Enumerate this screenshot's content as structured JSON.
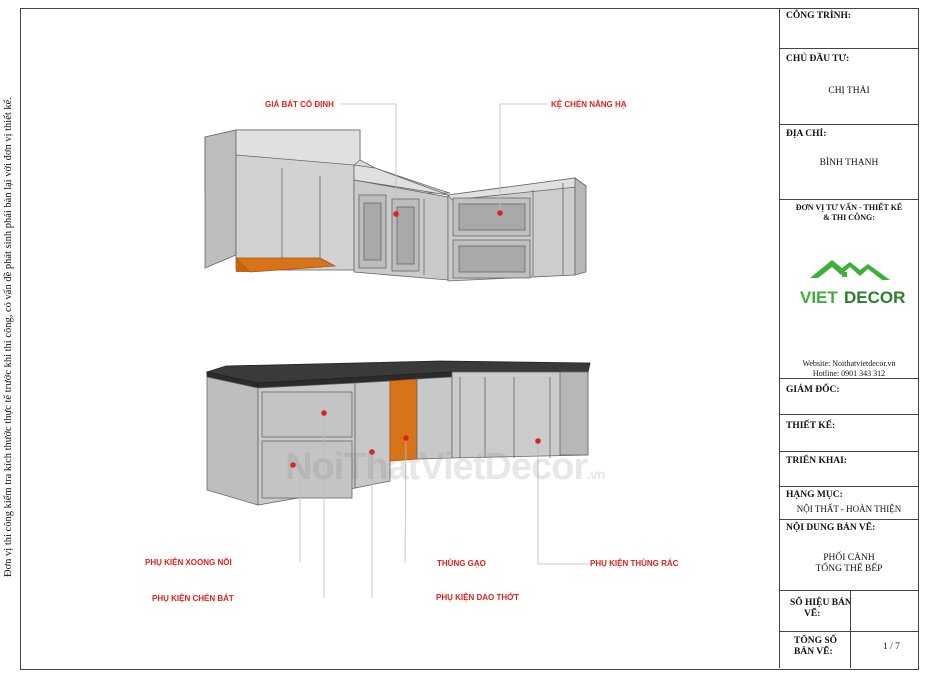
{
  "side_note": "Đơn vị thi công kiểm tra kích thước thực tế trước khi thi công, có vấn đề phát sinh phải bàn lại với đơn vị thiết kế.",
  "watermark": {
    "main": "NoiThatVietDecor",
    "suffix": ".vn"
  },
  "callouts": {
    "fixed_dish_rack": "GIÁ BÁT CỐ ĐỊNH",
    "lift_rack": "KỆ CHÉN NÂNG HẠ",
    "pot_accessory": "PHỤ KIỆN XOONG NỒI",
    "dish_accessory": "PHỤ KIỆN CHÉN BÁT",
    "rice_bin": "THÙNG GẠO",
    "knife_accessory": "PHỤ KIỆN DAO THỚT",
    "trash_bin": "PHỤ KIỆN THÙNG RÁC"
  },
  "title_block": {
    "project_label": "CÔNG TRÌNH:",
    "owner_label": "CHỦ ĐẦU TƯ:",
    "owner_value": "CHỊ THẢI",
    "address_label": "ĐỊA CHỈ:",
    "address_value": "BÌNH THẠNH",
    "company_label_1": "ĐƠN VỊ TƯ VẤN - THIẾT KẾ",
    "company_label_2": "& THI CÔNG:",
    "logo_text_1": "VIET",
    "logo_text_2": "DECOR",
    "website": "Website: Noithatvietdecor.vn",
    "hotline": "Hotline: 0901 343 312",
    "director_label": "GIÁM ĐỐC:",
    "design_label": "THIẾT KẾ:",
    "deploy_label": "TRIỂN KHAI:",
    "category_label": "HẠNG MỤC:",
    "category_value": "NỘI THẤT - HOÀN THIỆN",
    "content_label": "NỘI DUNG BẢN VẼ:",
    "content_value_1": "PHỐI CẢNH",
    "content_value_2": "TỔNG THỂ BẾP",
    "sheet_no_label_1": "SỐ HIỆU BẢN",
    "sheet_no_label_2": "VẼ:",
    "total_label_1": "TỔNG SỐ",
    "total_label_2": "BẢN VẼ:",
    "total_value": "1 / 7"
  },
  "colors": {
    "callout": "#e0201c",
    "orange": "#d9731a",
    "logo_green": "#3fae3a",
    "cabinet": "#cfcfcf"
  }
}
